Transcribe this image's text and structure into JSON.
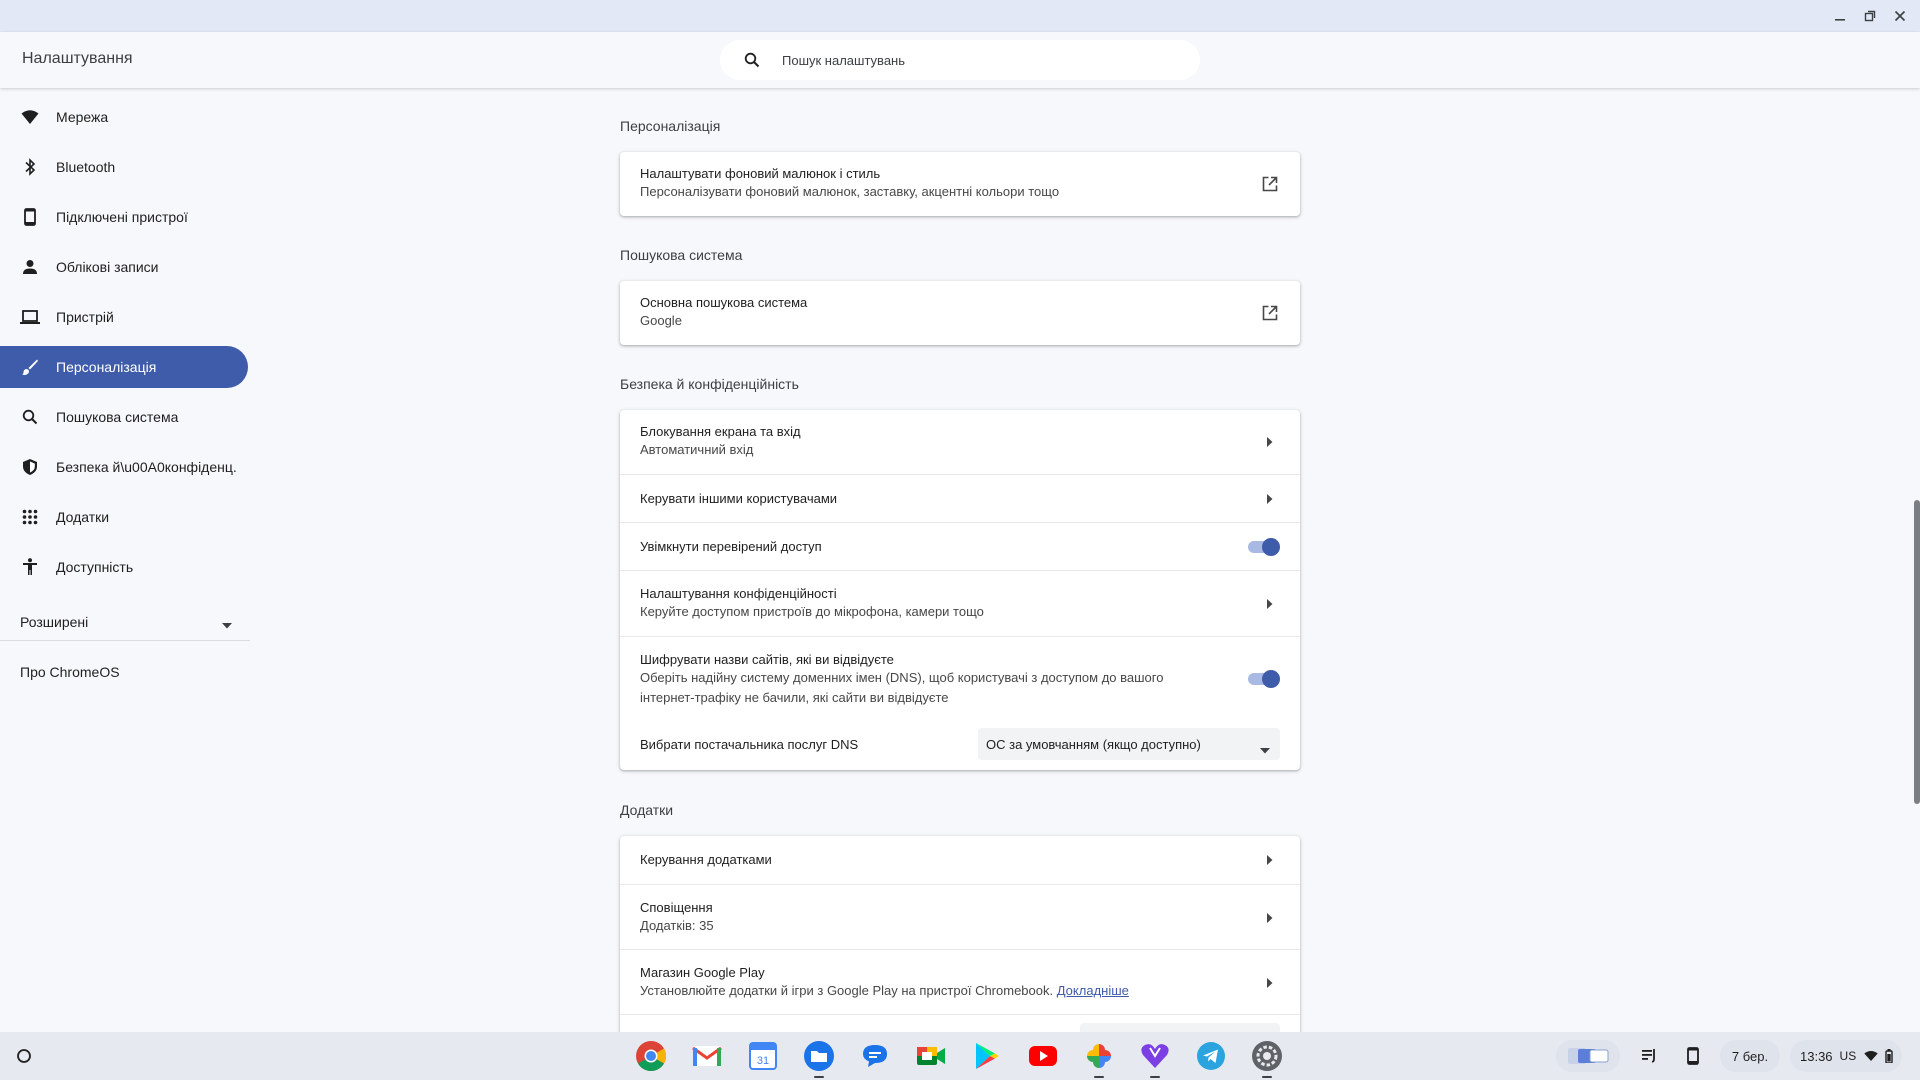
{
  "window": {
    "minimize_icon": "minimize-icon",
    "maximize_icon": "restore-icon",
    "close_icon": "close-icon"
  },
  "header": {
    "title": "Налаштування",
    "search_placeholder": "Пошук налаштувань"
  },
  "sidebar": {
    "items": [
      {
        "label": "Мережа",
        "icon": "wifi-icon"
      },
      {
        "label": "Bluetooth",
        "icon": "bluetooth-icon"
      },
      {
        "label": "Підключені пристрої",
        "icon": "phone-icon"
      },
      {
        "label": "Облікові записи",
        "icon": "person-icon"
      },
      {
        "label": "Пристрій",
        "icon": "laptop-icon"
      },
      {
        "label": "Персоналізація",
        "icon": "brush-icon",
        "active": true
      },
      {
        "label": "Пошукова система",
        "icon": "search-icon"
      },
      {
        "label": "Безпека й\\u00A0конфіденц.",
        "icon": "shield-icon"
      },
      {
        "label": "Додатки",
        "icon": "apps-grid-icon"
      },
      {
        "label": "Доступність",
        "icon": "accessibility-icon"
      }
    ],
    "advanced": "Розширені",
    "about": "Про ChromeOS"
  },
  "main": {
    "personalization": {
      "title": "Персоналізація",
      "row": {
        "primary": "Налаштувати фоновий малюнок і стиль",
        "secondary": "Персоналізувати фоновий малюнок, заставку, акцентні кольори тощо"
      }
    },
    "search_engine": {
      "title": "Пошукова система",
      "row": {
        "primary": "Основна пошукова система",
        "secondary": "Google"
      }
    },
    "security": {
      "title": "Безпека й конфіденційність",
      "rows": [
        {
          "primary": "Блокування екрана та вхід",
          "secondary": "Автоматичний вхід"
        },
        {
          "primary": "Керувати іншими користувачами"
        },
        {
          "primary": "Увімкнути перевірений доступ",
          "toggle": true
        },
        {
          "primary": "Налаштування конфіденційності",
          "secondary": "Керуйте доступом пристроїв до мікрофона, камери тощо"
        },
        {
          "primary": "Шифрувати назви сайтів, які ви відвідуєте",
          "secondary": "Оберіть надійну систему доменних імен (DNS), щоб користувачі з доступом до вашого",
          "secondary2": "інтернет-трафіку не бачили, які сайти ви відвідуєте",
          "toggle": true
        },
        {
          "primary": "Вибрати постачальника послуг DNS",
          "select_value": "ОС за умовчанням (якщо доступно)"
        }
      ]
    },
    "apps": {
      "title": "Додатки",
      "rows": [
        {
          "primary": "Керування додатками"
        },
        {
          "primary": "Сповіщення",
          "secondary": "Додатків: 35"
        },
        {
          "primary": "Магазин Google Play",
          "secondary": "Установлюйте додатки й ігри з Google Play на пристрої Chromebook.",
          "link": "Докладніше"
        }
      ]
    }
  },
  "shelf": {
    "apps": [
      "chrome-icon",
      "gmail-icon",
      "calendar-icon",
      "files-icon",
      "messages-icon",
      "meet-icon",
      "play-store-icon",
      "youtube-icon",
      "photos-icon",
      "heart-app-icon",
      "telegram-icon",
      "settings-icon"
    ],
    "date": "7 бер.",
    "time": "13:36",
    "keyboard_layout": "US"
  },
  "colors": {
    "accent": "#3f5caa",
    "background": "#f7f8fb",
    "titlebar": "#e3e8f6"
  }
}
